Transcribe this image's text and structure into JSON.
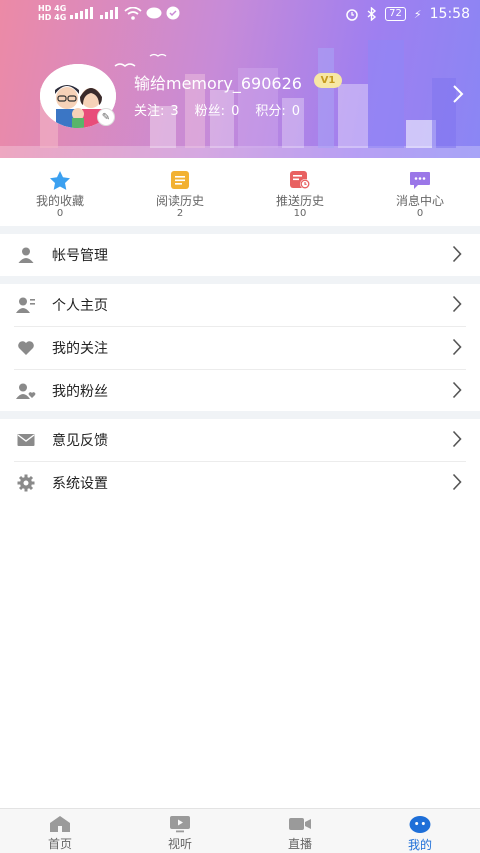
{
  "status_bar": {
    "left_labels": [
      "HD",
      "4G",
      "HD",
      "4G"
    ],
    "battery": "72",
    "time": "15:58"
  },
  "profile": {
    "username": "输给memory_690626",
    "level": "V1",
    "stats": [
      {
        "label": "关注:",
        "value": "3"
      },
      {
        "label": "粉丝:",
        "value": "0"
      },
      {
        "label": "积分:",
        "value": "0"
      }
    ]
  },
  "quick_actions": [
    {
      "label": "我的收藏",
      "count": "0",
      "icon": "star-icon",
      "color": "#3ba0f0"
    },
    {
      "label": "阅读历史",
      "count": "2",
      "icon": "reading-history-icon",
      "color": "#f2b132"
    },
    {
      "label": "推送历史",
      "count": "10",
      "icon": "push-history-icon",
      "color": "#e86161"
    },
    {
      "label": "消息中心",
      "count": "0",
      "icon": "message-icon",
      "color": "#9b77e8"
    }
  ],
  "menu": {
    "account": "帐号管理",
    "homepage": "个人主页",
    "following": "我的关注",
    "fans": "我的粉丝",
    "feedback": "意见反馈",
    "settings": "系统设置"
  },
  "bottom_nav": [
    {
      "label": "首页",
      "icon": "home-icon"
    },
    {
      "label": "视听",
      "icon": "video-icon"
    },
    {
      "label": "直播",
      "icon": "live-camera-icon"
    },
    {
      "label": "我的",
      "icon": "mine-icon",
      "active": true
    }
  ],
  "colors": {
    "accent": "#1e6fd8",
    "menu_icon": "#8a8a8a",
    "section_gap": "#f0f3f6"
  }
}
